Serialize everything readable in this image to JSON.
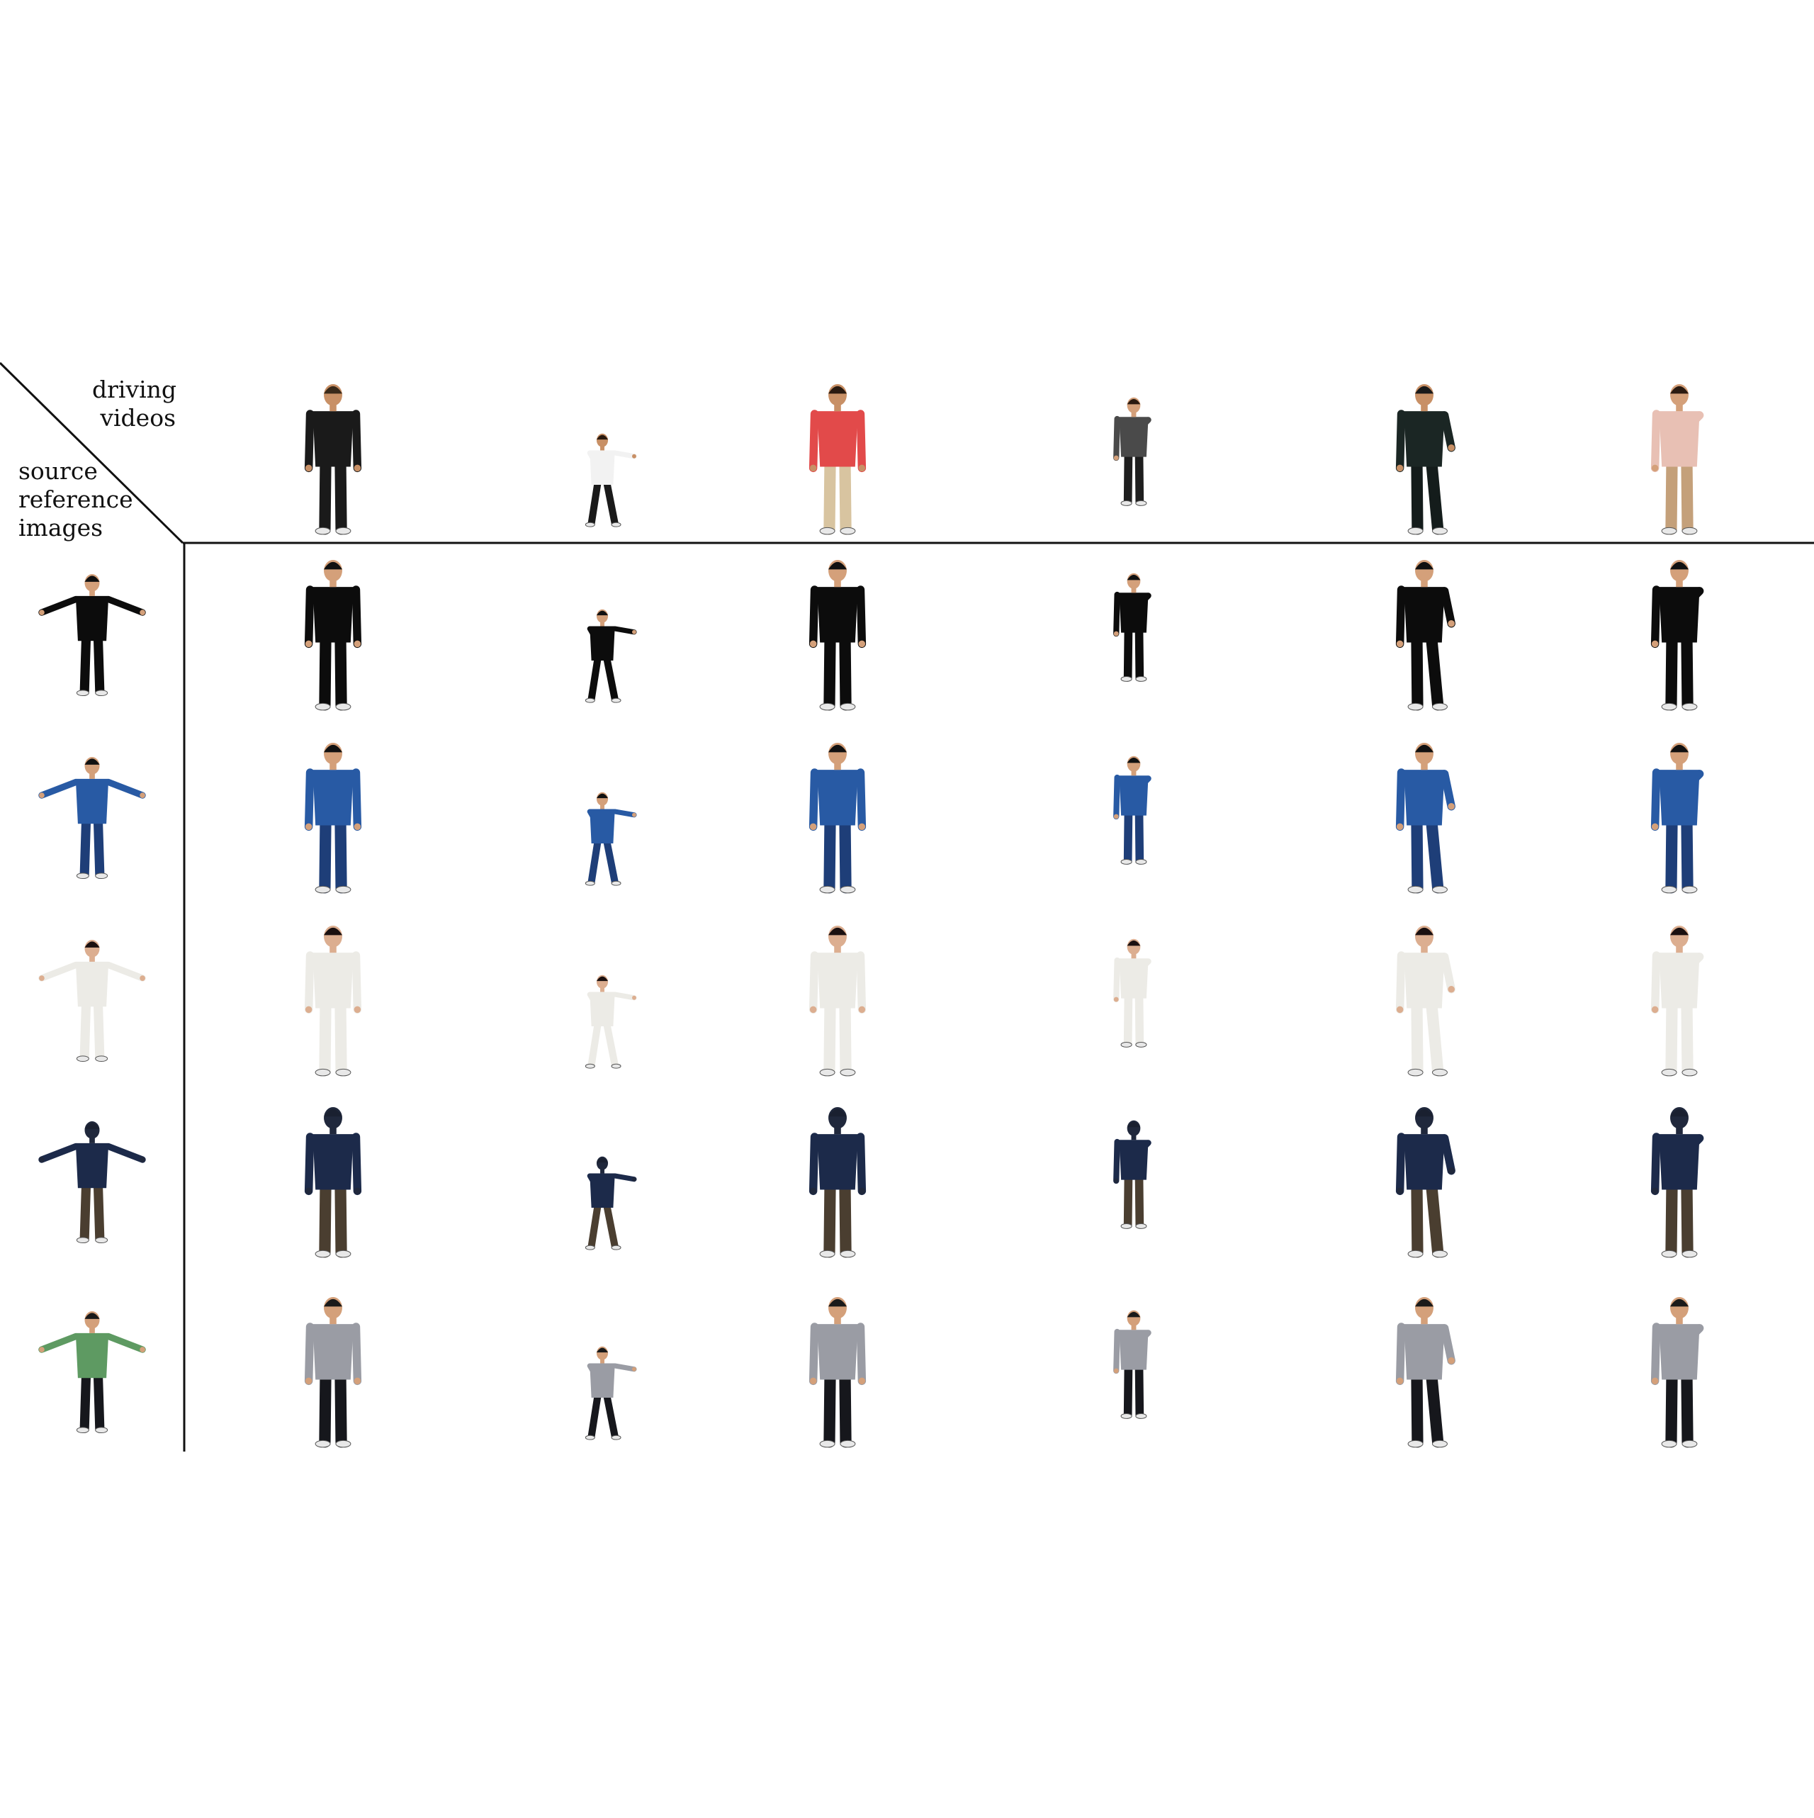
{
  "header": {
    "driving_label": [
      "driving",
      "videos"
    ],
    "source_label": [
      "source",
      "reference",
      "images"
    ]
  },
  "columns": [
    {
      "pose": "stand-front",
      "source_top": "#1a1a1a",
      "source_bottom": "#1a1a1a",
      "source_skin": "#c89066",
      "source_hair": "#3a2a1a"
    },
    {
      "pose": "dance-side",
      "source_top": "#f2f2f2",
      "source_bottom": "#1a1a1a",
      "source_skin": "#c89066",
      "source_hair": "#2a1a10"
    },
    {
      "pose": "stand-back",
      "source_top": "#e24a4a",
      "source_bottom": "#d8c4a0",
      "source_skin": "#c89066",
      "source_hair": "#2a1a10"
    },
    {
      "pose": "walk-front",
      "source_top": "#4a4a4a",
      "source_bottom": "#1e1e1e",
      "source_skin": "#d4a07a",
      "source_hair": "#2a1a10"
    },
    {
      "pose": "lean-hand",
      "source_top": "#1b2624",
      "source_bottom": "#141c1b",
      "source_skin": "#c89066",
      "source_hair": "#1a1a1a"
    },
    {
      "pose": "stand-hand",
      "source_top": "#e8c0b4",
      "source_bottom": "#c4a07a",
      "source_skin": "#d4a07a",
      "source_hair": "#2a1a10"
    }
  ],
  "rows": [
    {
      "top": "#0c0c0c",
      "bottom": "#0c0c0c",
      "skin": "#d4a07a",
      "hair": "#111111"
    },
    {
      "top": "#285aa4",
      "bottom": "#1e3e78",
      "skin": "#d4a07a",
      "hair": "#111111"
    },
    {
      "top": "#ecebe6",
      "bottom": "#ecebe6",
      "skin": "#dcae90",
      "hair": "#1a1010"
    },
    {
      "top": "#1c2a4a",
      "bottom": "#4a3e30",
      "skin": "#20283c",
      "hair": "#1a2030"
    },
    {
      "top": "#9a9ca4",
      "bottom": "#16171c",
      "skin": "#d4a07a",
      "hair": "#1a1a1a"
    }
  ],
  "source_ref_top_colors": [
    "#0c0c0c",
    "#285aa4",
    "#ecebe6",
    "#1c2a4a",
    "#5e9a62"
  ]
}
